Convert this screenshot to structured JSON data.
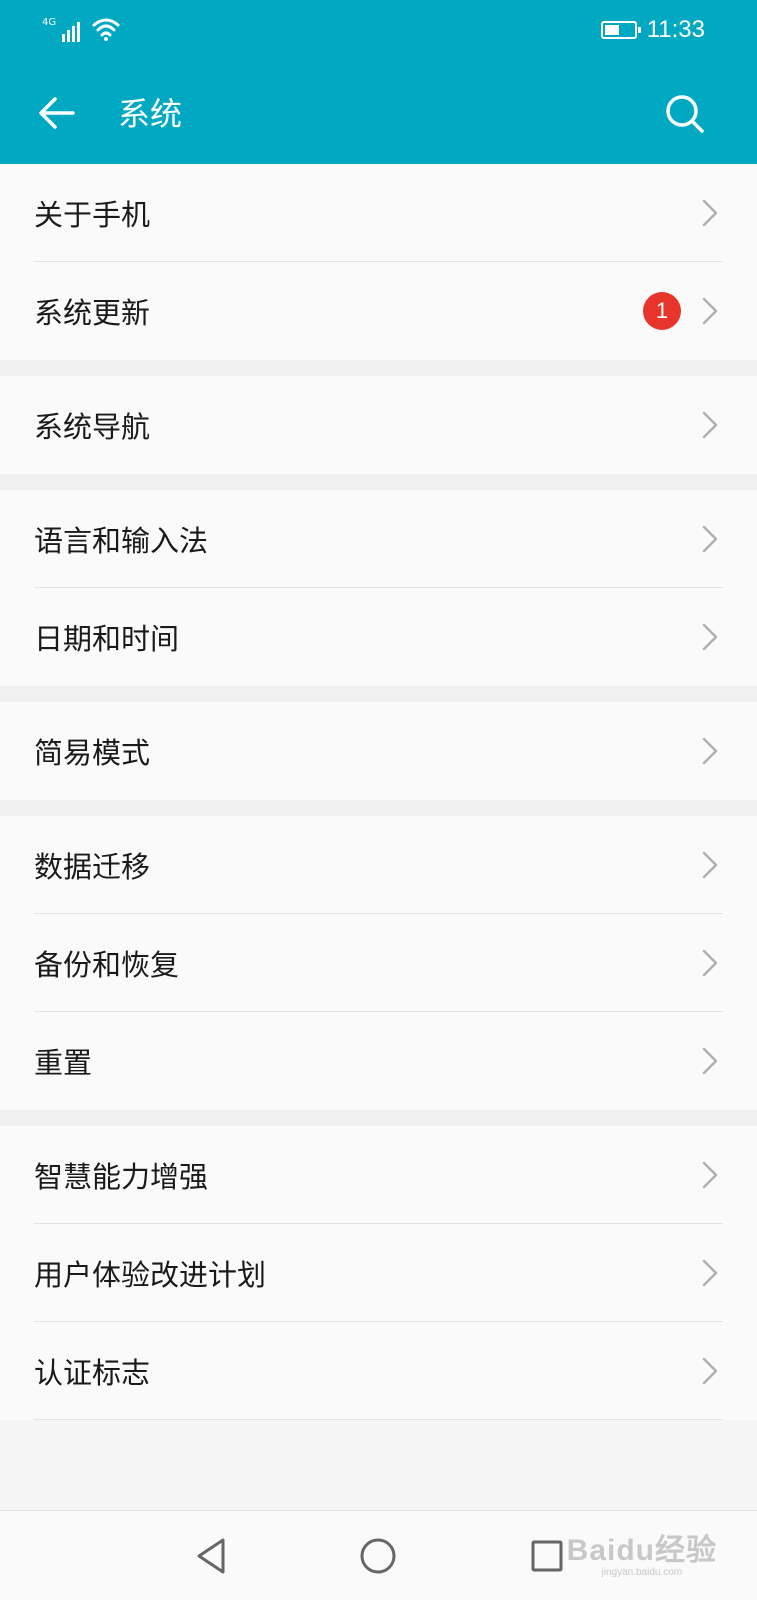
{
  "status_bar": {
    "network_label": "4G",
    "time": "11:33",
    "battery_level": 0.5
  },
  "toolbar": {
    "title": "系统",
    "back_icon": "arrow-left-icon",
    "search_icon": "search-icon"
  },
  "groups": [
    {
      "items": [
        {
          "label": "关于手机"
        },
        {
          "label": "系统更新",
          "badge": "1"
        }
      ]
    },
    {
      "items": [
        {
          "label": "系统导航"
        }
      ]
    },
    {
      "items": [
        {
          "label": "语言和输入法"
        },
        {
          "label": "日期和时间"
        }
      ]
    },
    {
      "items": [
        {
          "label": "简易模式"
        }
      ]
    },
    {
      "items": [
        {
          "label": "数据迁移"
        },
        {
          "label": "备份和恢复"
        },
        {
          "label": "重置"
        }
      ]
    },
    {
      "items": [
        {
          "label": "智慧能力增强"
        },
        {
          "label": "用户体验改进计划"
        },
        {
          "label": "认证标志"
        }
      ]
    }
  ],
  "watermark": {
    "main": "Baidu经验",
    "sub": "jingyan.baidu.com"
  },
  "colors": {
    "accent": "#00a8c2",
    "badge": "#e8352b"
  }
}
